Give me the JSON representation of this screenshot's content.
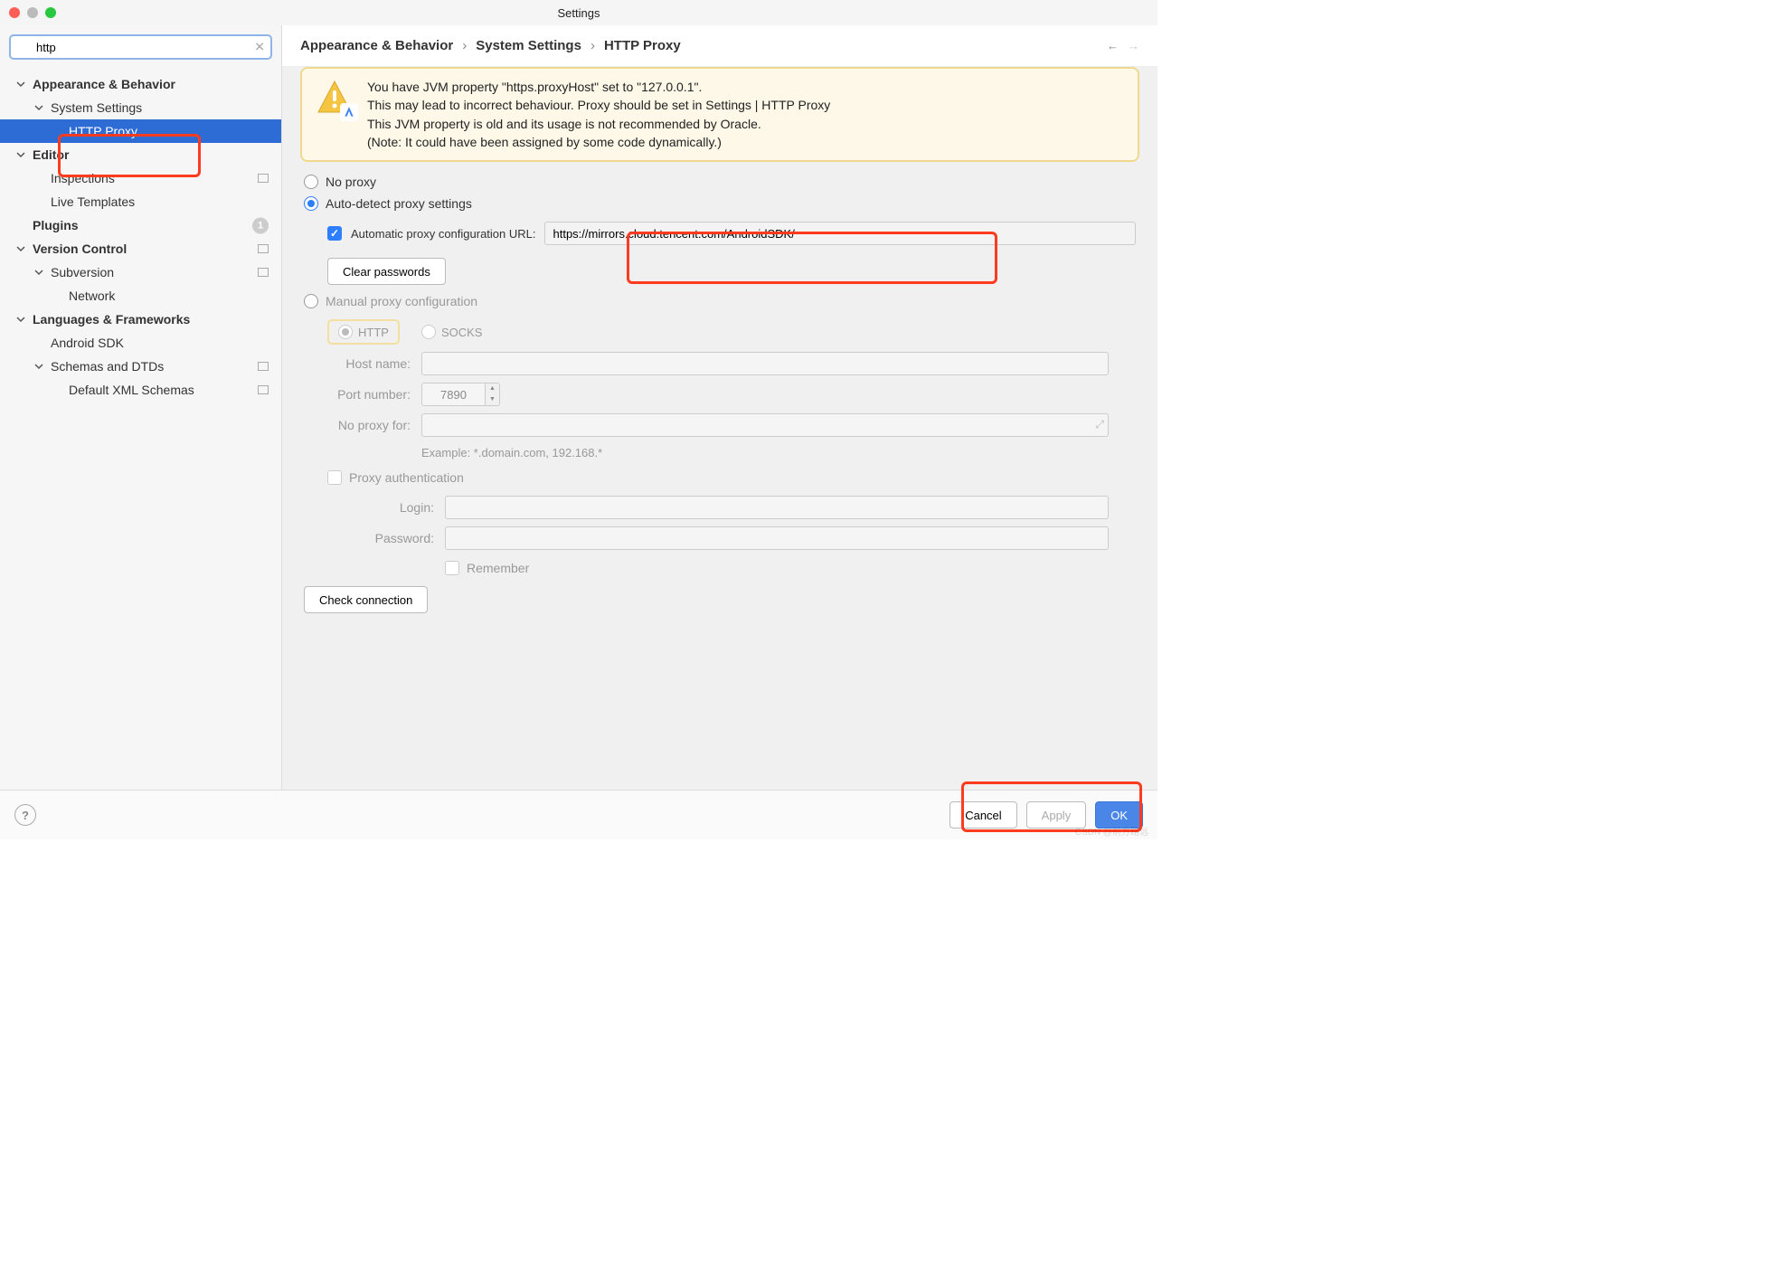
{
  "window": {
    "title": "Settings"
  },
  "search": {
    "value": "http",
    "placeholder": ""
  },
  "sidebar": {
    "items": [
      {
        "label": "Appearance & Behavior"
      },
      {
        "label": "System Settings"
      },
      {
        "label": "HTTP Proxy"
      },
      {
        "label": "Editor"
      },
      {
        "label": "Inspections"
      },
      {
        "label": "Live Templates"
      },
      {
        "label": "Plugins",
        "badge": "1"
      },
      {
        "label": "Version Control"
      },
      {
        "label": "Subversion"
      },
      {
        "label": "Network"
      },
      {
        "label": "Languages & Frameworks"
      },
      {
        "label": "Android SDK"
      },
      {
        "label": "Schemas and DTDs"
      },
      {
        "label": "Default XML Schemas"
      }
    ]
  },
  "breadcrumb": {
    "a": "Appearance & Behavior",
    "b": "System Settings",
    "c": "HTTP Proxy"
  },
  "warning": {
    "line1": "You have JVM property \"https.proxyHost\" set to \"127.0.0.1\".",
    "line2": "This may lead to incorrect behaviour. Proxy should be set in Settings | HTTP Proxy",
    "line3": "This JVM property is old and its usage is not recommended by Oracle.",
    "line4": "(Note: It could have been assigned by some code dynamically.)"
  },
  "proxy": {
    "no_proxy": "No proxy",
    "auto_detect": "Auto-detect proxy settings",
    "auto_url_label": "Automatic proxy configuration URL:",
    "auto_url_value": "https://mirrors.cloud.tencent.com/AndroidSDK/",
    "clear_pw": "Clear passwords",
    "manual": "Manual proxy configuration",
    "http": "HTTP",
    "socks": "SOCKS",
    "host_label": "Host name:",
    "host_value": "",
    "port_label": "Port number:",
    "port_value": "7890",
    "noproxy_label": "No proxy for:",
    "example": "Example: *.domain.com, 192.168.*",
    "auth": "Proxy authentication",
    "login_label": "Login:",
    "password_label": "Password:",
    "remember": "Remember",
    "check": "Check connection"
  },
  "footer": {
    "cancel": "Cancel",
    "apply": "Apply",
    "ok": "OK"
  },
  "watermark": "CSDN @前方路远"
}
